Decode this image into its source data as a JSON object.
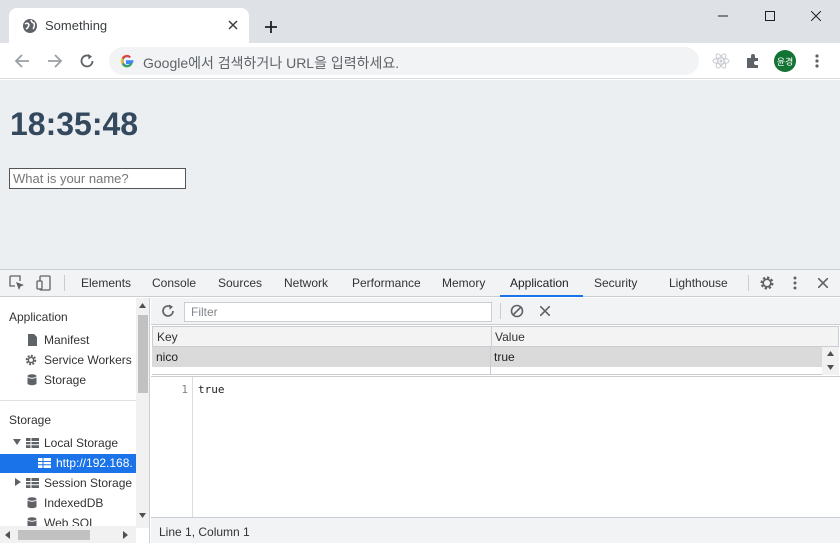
{
  "browser": {
    "tab_title": "Something",
    "omnibox_placeholder": "Google에서 검색하거나 URL을 입력하세요.",
    "profile_name": "윤경"
  },
  "page": {
    "clock": "18:35:48",
    "name_placeholder": "What is your name?"
  },
  "devtools": {
    "tabs": [
      "Elements",
      "Console",
      "Sources",
      "Network",
      "Performance",
      "Memory",
      "Application",
      "Security",
      "Lighthouse"
    ],
    "active_tab": "Application",
    "sidebar": {
      "application_heading": "Application",
      "application_items": [
        "Manifest",
        "Service Workers",
        "Storage"
      ],
      "storage_heading": "Storage",
      "local_storage": "Local Storage",
      "local_storage_origin": "http://192.168.",
      "session_storage": "Session Storage",
      "indexeddb": "IndexedDB",
      "websql": "Web SQL"
    },
    "filter_placeholder": "Filter",
    "table": {
      "columns": [
        "Key",
        "Value"
      ],
      "rows": [
        {
          "key": "nico",
          "value": "true"
        }
      ]
    },
    "editor": {
      "line_number": "1",
      "content": "true"
    },
    "status": "Line 1, Column 1"
  },
  "colors": {
    "accent": "#1a73e8",
    "clock": "#34495e",
    "viewport_bg": "#eceff1",
    "avatar_bg": "#137333"
  }
}
